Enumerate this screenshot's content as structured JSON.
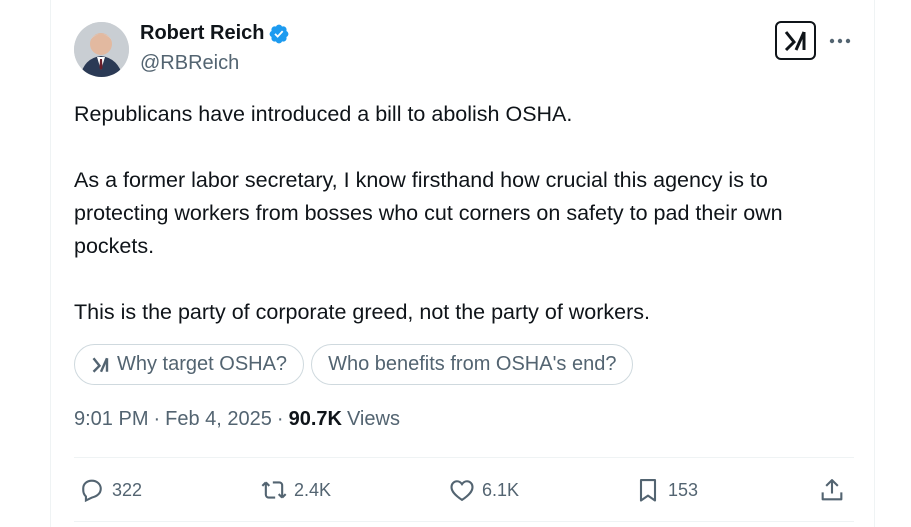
{
  "author": {
    "name": "Robert Reich",
    "handle": "@RBReich",
    "verified": true
  },
  "post": {
    "paragraphs": [
      "Republicans have introduced a bill to abolish OSHA.",
      "As a former labor secretary, I know firsthand how crucial this agency is to protecting workers from bosses who cut corners on safety to pad their own pockets.",
      "This is the party of corporate greed, not the party of workers."
    ]
  },
  "grok_chips": [
    {
      "label": "Why target OSHA?",
      "icon": "grok-icon"
    },
    {
      "label": "Who benefits from OSHA's end?"
    }
  ],
  "meta": {
    "time": "9:01 PM",
    "separator1": "·",
    "date": "Feb 4, 2025",
    "separator2": "·",
    "views_count": "90.7K",
    "views_label": "Views"
  },
  "actions": {
    "replies": "322",
    "reposts": "2.4K",
    "likes": "6.1K",
    "bookmarks": "153"
  },
  "colors": {
    "verified_blue": "#1d9bf0",
    "text_primary": "#0f1419",
    "text_secondary": "#536471",
    "border": "#eff3f4"
  }
}
